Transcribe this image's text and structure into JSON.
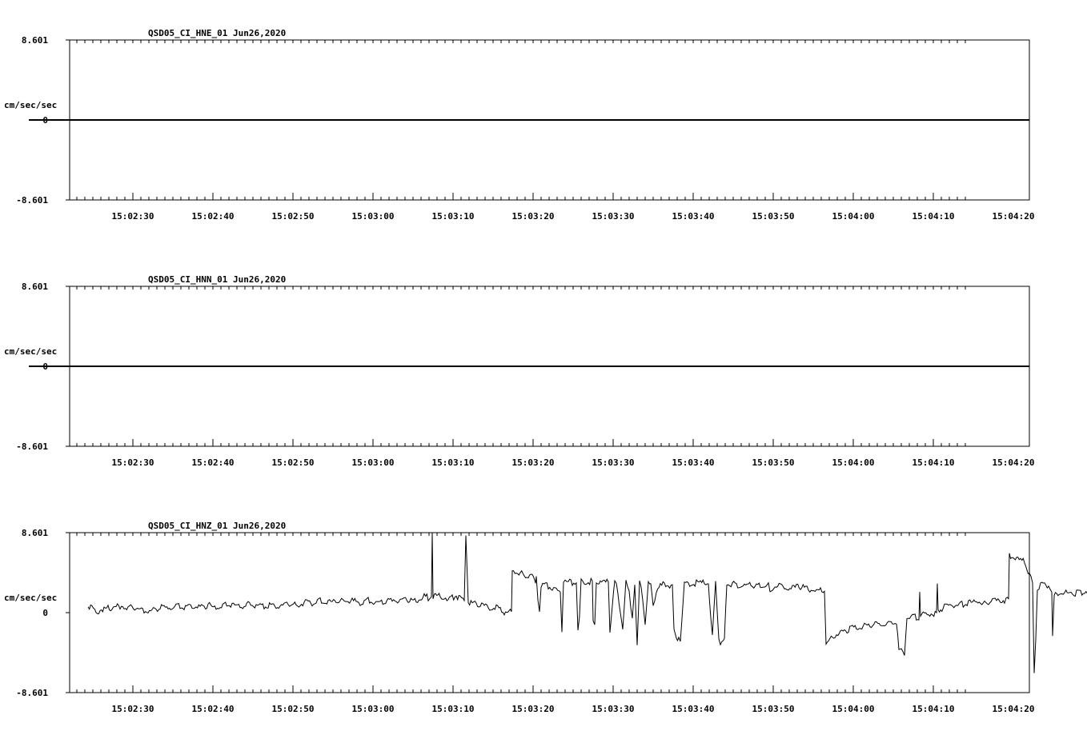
{
  "chart_data": [
    {
      "type": "line",
      "title": "QSD05_CI_HNE_01  Jun26,2020",
      "ylabel": "cm/sec/sec",
      "ytick_labels": [
        "8.601",
        "0",
        "-8.601"
      ],
      "ylim": [
        -8.601,
        8.601
      ],
      "xlim_seconds": [
        15,
        135
      ],
      "xtick_labels": [
        "15:02:30",
        "15:02:40",
        "15:02:50",
        "15:03:00",
        "15:03:10",
        "15:03:20",
        "15:03:30",
        "15:03:40",
        "15:03:50",
        "15:04:00",
        "15:04:10",
        "15:04:20"
      ],
      "series": [
        {
          "x_start": "15:02:24",
          "x_end": "15:04:22",
          "values": [
            0,
            0,
            0,
            0,
            0,
            0,
            0,
            0,
            0,
            0
          ]
        }
      ]
    },
    {
      "type": "line",
      "title": "QSD05_CI_HNN_01  Jun26,2020",
      "ylabel": "cm/sec/sec",
      "ytick_labels": [
        "8.601",
        "0",
        "-8.601"
      ],
      "ylim": [
        -8.601,
        8.601
      ],
      "xlim_seconds": [
        15,
        135
      ],
      "xtick_labels": [
        "15:02:30",
        "15:02:40",
        "15:02:50",
        "15:03:00",
        "15:03:10",
        "15:03:20",
        "15:03:30",
        "15:03:40",
        "15:03:50",
        "15:04:00",
        "15:04:10",
        "15:04:20"
      ],
      "series": [
        {
          "x_start": "15:02:24",
          "x_end": "15:04:22",
          "values": [
            0,
            0,
            0,
            0,
            0,
            0,
            0,
            0,
            0,
            0
          ]
        }
      ]
    },
    {
      "type": "line",
      "title": "QSD05_CI_HNZ_01  Jun26,2020",
      "ylabel": "cm/sec/sec",
      "ytick_labels": [
        "8.601",
        "0",
        "-8.601"
      ],
      "ylim": [
        -8.601,
        8.601
      ],
      "xlim_seconds": [
        15,
        135
      ],
      "xtick_labels": [
        "15:02:30",
        "15:02:40",
        "15:02:50",
        "15:03:00",
        "15:03:10",
        "15:03:20",
        "15:03:30",
        "15:03:40",
        "15:03:50",
        "15:04:00",
        "15:04:10",
        "15:04:20"
      ],
      "series": [
        {
          "x_start": "15:02:24",
          "x_end": "15:04:22",
          "points": [
            [
              16.0,
              0.7
            ],
            [
              17.0,
              0.1
            ],
            [
              18.0,
              0.4
            ],
            [
              19.0,
              0.5
            ],
            [
              20.0,
              0.7
            ],
            [
              21.0,
              0.6
            ],
            [
              22.0,
              0.4
            ],
            [
              23.0,
              0.3
            ],
            [
              24.0,
              0.2
            ],
            [
              25.0,
              0.6
            ],
            [
              26.0,
              0.5
            ],
            [
              27.0,
              0.8
            ],
            [
              28.0,
              0.6
            ],
            [
              29.0,
              0.7
            ],
            [
              30.0,
              0.6
            ],
            [
              31.0,
              0.8
            ],
            [
              32.0,
              0.5
            ],
            [
              33.0,
              0.8
            ],
            [
              34.0,
              0.9
            ],
            [
              35.0,
              0.6
            ],
            [
              36.0,
              1.0
            ],
            [
              37.0,
              0.8
            ],
            [
              38.0,
              0.7
            ],
            [
              39.0,
              0.9
            ],
            [
              40.0,
              0.6
            ],
            [
              41.0,
              1.0
            ],
            [
              42.0,
              0.8
            ],
            [
              43.0,
              1.1
            ],
            [
              44.0,
              0.9
            ],
            [
              45.0,
              1.3
            ],
            [
              46.0,
              1.1
            ],
            [
              47.0,
              1.2
            ],
            [
              48.0,
              1.2
            ],
            [
              49.0,
              1.3
            ],
            [
              50.0,
              1.0
            ],
            [
              51.0,
              1.4
            ],
            [
              52.0,
              1.1
            ],
            [
              53.0,
              1.2
            ],
            [
              54.0,
              1.5
            ],
            [
              55.0,
              1.3
            ],
            [
              56.0,
              1.4
            ],
            [
              57.0,
              1.3
            ],
            [
              58.0,
              1.8
            ],
            [
              58.5,
              1.6
            ],
            [
              58.9,
              1.7
            ],
            [
              59.0,
              8.6
            ],
            [
              59.1,
              1.6
            ],
            [
              60.0,
              1.9
            ],
            [
              61.0,
              1.4
            ],
            [
              62.0,
              1.8
            ],
            [
              63.0,
              1.3
            ],
            [
              63.2,
              8.3
            ],
            [
              63.5,
              1.2
            ],
            [
              64.0,
              1.0
            ],
            [
              65.0,
              0.9
            ],
            [
              66.0,
              0.6
            ],
            [
              67.0,
              0.5
            ],
            [
              68.0,
              0.0
            ],
            [
              68.9,
              0.1
            ],
            [
              69.0,
              4.6
            ],
            [
              70.0,
              4.2
            ],
            [
              71.0,
              4.0
            ],
            [
              71.8,
              3.7
            ],
            [
              71.9,
              3.2
            ],
            [
              72.0,
              4.0
            ],
            [
              72.2,
              1.4
            ],
            [
              72.4,
              0.4
            ],
            [
              72.6,
              2.5
            ],
            [
              72.8,
              2.9
            ],
            [
              73.0,
              3.1
            ],
            [
              74.0,
              2.6
            ],
            [
              75.0,
              2.2
            ],
            [
              75.2,
              -2.1
            ],
            [
              75.4,
              3.5
            ],
            [
              75.6,
              3.2
            ],
            [
              76.0,
              3.3
            ],
            [
              77.0,
              3.2
            ],
            [
              77.2,
              -2.1
            ],
            [
              77.4,
              -0.4
            ],
            [
              77.6,
              3.3
            ],
            [
              78.0,
              3.2
            ],
            [
              79.0,
              3.4
            ],
            [
              79.1,
              -1.0
            ],
            [
              79.3,
              -1.3
            ],
            [
              79.5,
              3.3
            ],
            [
              80.0,
              3.2
            ],
            [
              81.0,
              3.3
            ],
            [
              81.2,
              -1.8
            ],
            [
              81.5,
              0.5
            ],
            [
              81.8,
              3.3
            ],
            [
              82.0,
              3.1
            ],
            [
              82.5,
              0.2
            ],
            [
              82.8,
              -1.8
            ],
            [
              83.2,
              3.3
            ],
            [
              83.6,
              2.0
            ],
            [
              84.0,
              -0.6
            ],
            [
              84.3,
              3.0
            ],
            [
              84.6,
              -3.5
            ],
            [
              84.9,
              3.3
            ],
            [
              85.3,
              1.5
            ],
            [
              85.6,
              -1.3
            ],
            [
              86.0,
              3.2
            ],
            [
              86.3,
              2.9
            ],
            [
              86.6,
              0.5
            ],
            [
              87.0,
              2.5
            ],
            [
              87.5,
              2.8
            ],
            [
              88.0,
              3.1
            ],
            [
              88.5,
              2.9
            ],
            [
              89.0,
              3.0
            ],
            [
              89.2,
              -2.0
            ],
            [
              89.5,
              -3.0
            ],
            [
              89.8,
              -2.5
            ],
            [
              90.0,
              -3.1
            ],
            [
              90.5,
              3.1
            ],
            [
              91.0,
              3.0
            ],
            [
              92.0,
              3.2
            ],
            [
              93.0,
              3.2
            ],
            [
              93.5,
              3.1
            ],
            [
              93.8,
              -0.8
            ],
            [
              94.0,
              -2.4
            ],
            [
              94.4,
              3.4
            ],
            [
              94.8,
              -3.1
            ],
            [
              95.0,
              -3.7
            ],
            [
              95.5,
              -2.8
            ],
            [
              95.8,
              3.3
            ],
            [
              96.0,
              3.1
            ],
            [
              97.0,
              3.0
            ],
            [
              98.0,
              2.9
            ],
            [
              99.0,
              3.0
            ],
            [
              100.0,
              2.9
            ],
            [
              101.0,
              3.1
            ],
            [
              101.2,
              2.1
            ],
            [
              101.5,
              2.6
            ],
            [
              102.0,
              2.9
            ],
            [
              103.0,
              2.8
            ],
            [
              104.0,
              2.7
            ],
            [
              105.0,
              2.8
            ],
            [
              106.0,
              2.5
            ],
            [
              107.0,
              2.4
            ],
            [
              108.0,
              2.3
            ],
            [
              108.2,
              -3.5
            ],
            [
              109.0,
              -2.5
            ],
            [
              110.0,
              -2.2
            ],
            [
              111.0,
              -1.8
            ],
            [
              112.0,
              -1.6
            ],
            [
              113.0,
              -1.4
            ],
            [
              114.0,
              -1.3
            ],
            [
              115.0,
              -1.2
            ],
            [
              116.0,
              -1.0
            ],
            [
              117.0,
              -0.9
            ],
            [
              117.3,
              -4.3
            ],
            [
              117.6,
              -3.9
            ],
            [
              118.0,
              -4.6
            ],
            [
              118.3,
              -0.6
            ],
            [
              119.0,
              -0.4
            ],
            [
              119.8,
              -0.5
            ],
            [
              119.9,
              2.3
            ],
            [
              120.0,
              -0.3
            ],
            [
              121.0,
              -0.2
            ],
            [
              122.0,
              0.0
            ],
            [
              122.1,
              3.1
            ],
            [
              122.2,
              0.3
            ],
            [
              123.0,
              0.6
            ],
            [
              124.0,
              0.8
            ],
            [
              125.0,
              0.9
            ],
            [
              126.0,
              1.0
            ],
            [
              127.0,
              1.2
            ],
            [
              128.0,
              1.0
            ],
            [
              129.0,
              1.3
            ],
            [
              130.0,
              1.2
            ],
            [
              131.0,
              1.5
            ],
            [
              131.1,
              6.1
            ],
            [
              132.0,
              5.8
            ],
            [
              133.0,
              5.5
            ],
            [
              133.6,
              4.0
            ],
            [
              134.0,
              3.2
            ],
            [
              134.2,
              -6.5
            ],
            [
              134.4,
              -2.8
            ],
            [
              134.6,
              2.5
            ],
            [
              135.0,
              3.0
            ],
            [
              135.5,
              3.1
            ],
            [
              136.0,
              2.9
            ],
            [
              136.4,
              2.2
            ],
            [
              136.5,
              -2.5
            ],
            [
              136.7,
              1.8
            ],
            [
              137.0,
              2.0
            ],
            [
              138.0,
              2.1
            ],
            [
              139.0,
              2.0
            ],
            [
              140.0,
              2.2
            ],
            [
              141.0,
              2.3
            ],
            [
              142.0,
              2.2
            ],
            [
              143.0,
              2.4
            ],
            [
              143.9,
              2.1
            ],
            [
              144.0,
              0.6
            ]
          ]
        }
      ]
    }
  ]
}
